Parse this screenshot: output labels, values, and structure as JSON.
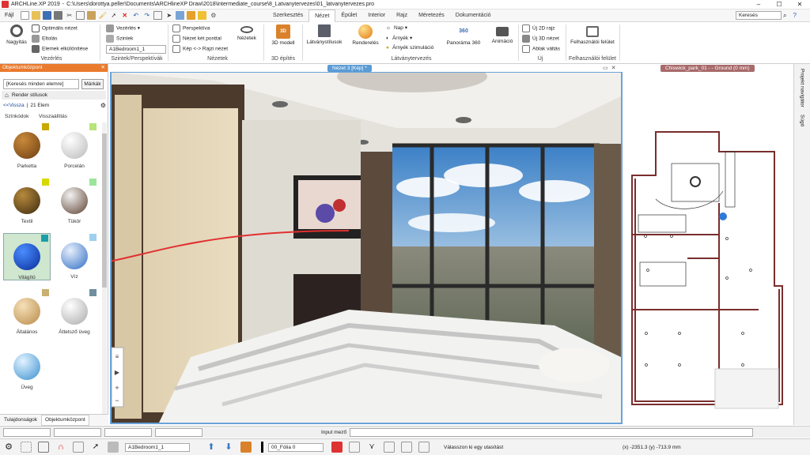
{
  "titlebar": {
    "app": "ARCHLine.XP 2019",
    "path": "C:\\Users\\dorottya.peller\\Documents\\ARCHlineXP Draw\\2018\\intermediate_course\\8_Latvanytervezes\\01_latvanytervezes.pro",
    "win_min": "–",
    "win_max": "☐",
    "win_close": "✕"
  },
  "qa": {
    "file": "Fájl",
    "search_placeholder": "Keresés"
  },
  "tabs": [
    "Szerkesztés",
    "Nézet",
    "Épület",
    "Interior",
    "Rajz",
    "Méretezés",
    "Dokumentáció"
  ],
  "active_tab": "Nézet",
  "ribbon": {
    "nagyitas": "Nagyítás",
    "optimalis": "Optimális nézet",
    "eltolas": "Eltolás",
    "elemek": "Elemek elkülönítése",
    "grp_vezerles": "Vezérlés",
    "vezerles": "Vezérlés",
    "szintek": "Szintek",
    "szint_value": "A1Bedroom1_1",
    "grp_szintek": "Szintek/Perspektívák",
    "perspektiva": "Perspektíva",
    "nezet_ket": "Nézet két ponttal",
    "kep_rajzi": "Kép <-> Rajzi nézet",
    "nezetek": "Nézetek",
    "grp_nezetek": "Nézetek",
    "modell3d": "3D modell",
    "grp_3d": "3D építés",
    "latvany": "Látványstílusok",
    "renderelés": "Renderelés",
    "nap": "Nap",
    "arnyek": "Árnyék",
    "arnyek_szim": "Árnyék szimuláció",
    "panorama": "Panoráma 360",
    "animacio": "Animáció",
    "grp_latvany": "Látványtervezés",
    "uj2d": "Új 2D rajz",
    "uj3d": "Új 3D nézet",
    "ablak": "Ablak váltás",
    "grp_uj": "Új",
    "felhasznaloi": "Felhasználói felület",
    "grp_felh": "Felhasználói felület"
  },
  "panel": {
    "title": "Objektumközpont",
    "search_placeholder": "[Keresés minden elemre]",
    "search_btn": "Márkák",
    "breadcrumb": "Render stílusok",
    "back": "<<Vissza",
    "count": "21 Elem",
    "szinkodok": "Színkódok",
    "visszaallitas": "Visszaállítás",
    "materials": [
      {
        "label": "Parketta",
        "c1": "#c8893a",
        "c2": "#6e3f12",
        "swatch": "#c9a800"
      },
      {
        "label": "Porcelán",
        "c1": "#ffffff",
        "c2": "#b9b9b9",
        "swatch": "#b8e47a"
      },
      {
        "label": "Textil",
        "c1": "#b78a3c",
        "c2": "#3d2a10",
        "swatch": "#d8d800"
      },
      {
        "label": "Tükör",
        "c1": "#f2f2f2",
        "c2": "#5d4030",
        "swatch": "#9be59b"
      },
      {
        "label": "Világító",
        "c1": "#4a8dff",
        "c2": "#0a2d9a",
        "swatch": "#1a9fa8"
      },
      {
        "label": "Víz",
        "c1": "#e8f0fb",
        "c2": "#2e6cc5",
        "swatch": "#9fd0ee"
      },
      {
        "label": "Általános",
        "c1": "#f6e0b8",
        "c2": "#b88a4a",
        "swatch": "#c9b070"
      },
      {
        "label": "Áttetsző üveg",
        "c1": "#ffffff",
        "c2": "#a9a9a9",
        "swatch": "#6f8f9f"
      },
      {
        "label": "Üveg",
        "c1": "#e2f3ff",
        "c2": "#3a8fd0",
        "swatch": ""
      }
    ],
    "tab1": "Tulajdonságok",
    "tab2": "Objektumközpont"
  },
  "view3d": {
    "title": "Nézet 3 [Kép] *"
  },
  "plan": {
    "title": "Chiswick_park_01 - - Ground (0 mm)"
  },
  "side_tabs": [
    "Projekt navigátor",
    "Súgó"
  ],
  "status": {
    "input_label": "Input mező",
    "layer": "A1Bedroom1_1",
    "folia": "00_Fólia 0",
    "prompt": "Válasszon ki egy utasítást",
    "coords": "(x) -2351.3  (y) -713.9 mm"
  },
  "colors": {
    "accent": "#e97a2e",
    "view_tab": "#5a9bd5",
    "plan_tab": "#a86a6a",
    "selected_bg": "#cfe6cf"
  }
}
